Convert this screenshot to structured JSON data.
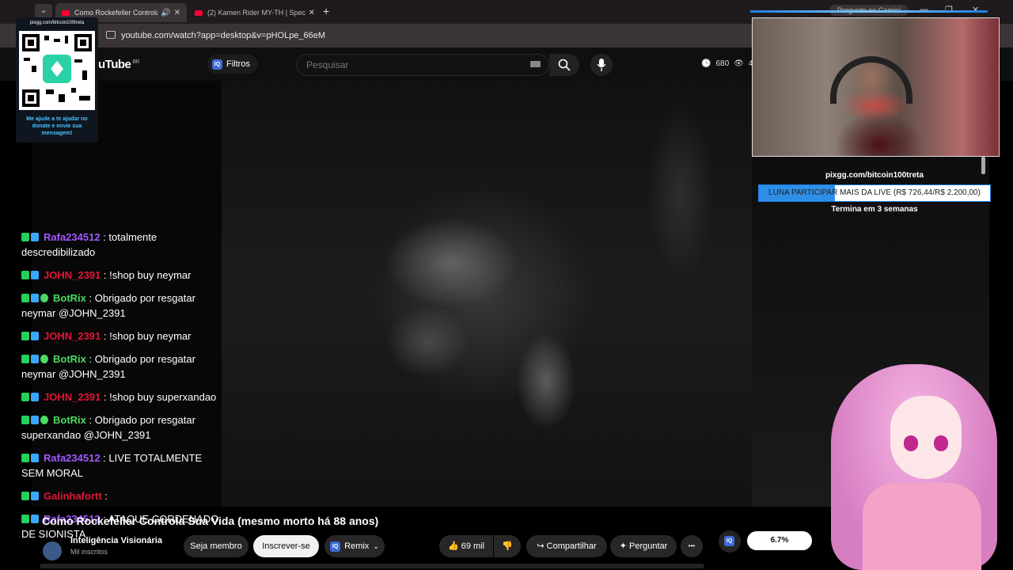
{
  "browser": {
    "tabs": [
      {
        "title": "Como Rockefeller Controla",
        "active": true
      },
      {
        "title": "(2) Kamen Rider MY-TH | Speci",
        "active": false
      }
    ],
    "new_tab": "+",
    "gemini": "Pergunte ao Gemini",
    "address": "youtube.com/watch?app=desktop&v=pHOLpe_66eM"
  },
  "youtube": {
    "logo": "uTube",
    "region": "BR",
    "filters_label": "Filtros",
    "iq_badge": "IQ",
    "search_placeholder": "Pesquisar",
    "stats": {
      "views": "680",
      "viewers": "4"
    }
  },
  "overlay": {
    "qr_url": "pixgg.com/bitcoin100treta",
    "qr_message": "Me ajude a te ajudar no donate e envie sua mensagem!",
    "pix_url": "pixgg.com/bitcoin100treta",
    "goal_label": "LUNA PARTICIPAR MAIS DA LIVE (R$ 726,44/R$ 2.200,00)",
    "goal_progress": 0.33,
    "goal_end": "Termina em 3 semanas"
  },
  "chat": [
    {
      "user": "Rafa234512",
      "text": "totalmente descredibilizado",
      "color": "#a259ff",
      "badges": [
        "k",
        "p"
      ]
    },
    {
      "user": "JOHN_2391",
      "text": "!shop buy neymar",
      "color": "#e0173a",
      "badges": [
        "k",
        "p"
      ]
    },
    {
      "user": "BotRix",
      "text": "Obrigado por resgatar neymar @JOHN_2391",
      "color": "#4cd964",
      "badges": [
        "k",
        "p",
        "g"
      ]
    },
    {
      "user": "JOHN_2391",
      "text": "!shop buy neymar",
      "color": "#e0173a",
      "badges": [
        "k",
        "p"
      ]
    },
    {
      "user": "BotRix",
      "text": "Obrigado por resgatar neymar @JOHN_2391",
      "color": "#4cd964",
      "badges": [
        "k",
        "p",
        "g"
      ]
    },
    {
      "user": "JOHN_2391",
      "text": "!shop buy superxandao",
      "color": "#e0173a",
      "badges": [
        "k",
        "p"
      ]
    },
    {
      "user": "BotRix",
      "text": "Obrigado por resgatar superxandao @JOHN_2391",
      "color": "#4cd964",
      "badges": [
        "k",
        "p",
        "g"
      ]
    },
    {
      "user": "Rafa234512",
      "text": "LIVE TOTALMENTE SEM MORAL",
      "color": "#a259ff",
      "badges": [
        "k",
        "p"
      ]
    },
    {
      "user": "Galinhafortt",
      "text": "",
      "color": "#e0173a",
      "badges": [
        "k",
        "p"
      ]
    },
    {
      "user": "Rafa234512",
      "text": "ATAQUE CORDENADO DE SIONISTA",
      "color": "#a259ff",
      "badges": [
        "k",
        "p"
      ]
    }
  ],
  "video": {
    "title": "Como Rockefeller Controla Sua Vida (mesmo morto há 88 anos)",
    "channel": "Inteligência Visionária",
    "subs": "Mil inscritos",
    "member_btn": "Seja membro",
    "subscribe_btn": "Inscrever-se",
    "remix_btn": "Remix",
    "likes": "69 mil",
    "share_btn": "Compartilhar",
    "ask_btn": "Perguntar",
    "more": "•••",
    "iq_percent": "6.7%"
  }
}
